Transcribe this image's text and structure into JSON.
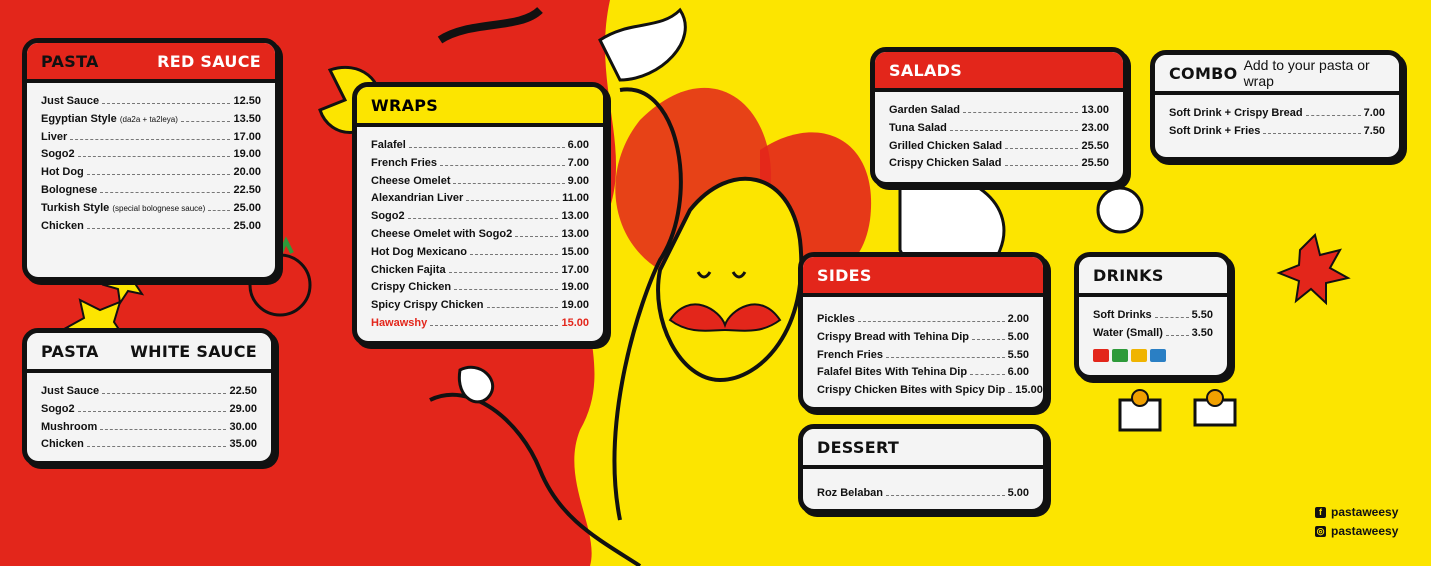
{
  "colors": {
    "red": "#e3261b",
    "yellow": "#fce500",
    "ink": "#111111"
  },
  "pasta_red": {
    "title": "PASTA",
    "subtitle": "RED SAUCE",
    "items": [
      {
        "name": "Just Sauce",
        "note": "",
        "price": "12.50"
      },
      {
        "name": "Egyptian Style",
        "note": "(da2a + ta2leya)",
        "price": "13.50"
      },
      {
        "name": "Liver",
        "note": "",
        "price": "17.00"
      },
      {
        "name": "Sogo2",
        "note": "",
        "price": "19.00"
      },
      {
        "name": "Hot Dog",
        "note": "",
        "price": "20.00"
      },
      {
        "name": "Bolognese",
        "note": "",
        "price": "22.50"
      },
      {
        "name": "Turkish Style",
        "note": "(special bolognese sauce)",
        "price": "25.00"
      },
      {
        "name": "Chicken",
        "note": "",
        "price": "25.00"
      }
    ]
  },
  "pasta_white": {
    "title": "PASTA",
    "subtitle": "WHITE SAUCE",
    "items": [
      {
        "name": "Just Sauce",
        "price": "22.50"
      },
      {
        "name": "Sogo2",
        "price": "29.00"
      },
      {
        "name": "Mushroom",
        "price": "30.00"
      },
      {
        "name": "Chicken",
        "price": "35.00"
      }
    ]
  },
  "wraps": {
    "title": "WRAPS",
    "items": [
      {
        "name": "Falafel",
        "price": "6.00"
      },
      {
        "name": "French Fries",
        "price": "7.00"
      },
      {
        "name": "Cheese Omelet",
        "price": "9.00"
      },
      {
        "name": "Alexandrian Liver",
        "price": "11.00"
      },
      {
        "name": "Sogo2",
        "price": "13.00"
      },
      {
        "name": "Cheese Omelet with Sogo2",
        "price": "13.00"
      },
      {
        "name": "Hot Dog Mexicano",
        "price": "15.00"
      },
      {
        "name": "Chicken Fajita",
        "price": "17.00"
      },
      {
        "name": "Crispy Chicken",
        "price": "19.00"
      },
      {
        "name": "Spicy Crispy Chicken",
        "price": "19.00"
      },
      {
        "name": "Hawawshy",
        "price": "15.00",
        "highlight": true
      }
    ]
  },
  "salads": {
    "title": "SALADS",
    "items": [
      {
        "name": "Garden Salad",
        "price": "13.00"
      },
      {
        "name": "Tuna Salad",
        "price": "23.00"
      },
      {
        "name": "Grilled Chicken Salad",
        "price": "25.50"
      },
      {
        "name": "Crispy Chicken Salad",
        "price": "25.50"
      }
    ]
  },
  "combo": {
    "title": "COMBO",
    "subtitle": "Add to your pasta or wrap",
    "items": [
      {
        "name": "Soft Drink + Crispy Bread",
        "price": "7.00"
      },
      {
        "name": "Soft Drink + Fries",
        "price": "7.50"
      }
    ]
  },
  "sides": {
    "title": "SIDES",
    "items": [
      {
        "name": "Pickles",
        "price": "2.00"
      },
      {
        "name": "Crispy Bread with Tehina Dip",
        "price": "5.00"
      },
      {
        "name": "French Fries",
        "price": "5.50"
      },
      {
        "name": "Falafel Bites With Tehina Dip",
        "price": "6.00"
      },
      {
        "name": "Crispy Chicken Bites with Spicy Dip",
        "price": "15.00"
      }
    ]
  },
  "drinks": {
    "title": "DRINKS",
    "items": [
      {
        "name": "Soft Drinks",
        "price": "5.50"
      },
      {
        "name": "Water (Small)",
        "price": "3.50"
      }
    ],
    "logos": [
      {
        "icon": "coca-cola-logo",
        "color": "#e3261b"
      },
      {
        "icon": "sprite-logo",
        "color": "#2e9a3a"
      },
      {
        "icon": "fanta-logo",
        "color": "#f0b400"
      },
      {
        "icon": "dasani-logo",
        "color": "#2a7fc4"
      }
    ]
  },
  "dessert": {
    "title": "DESSERT",
    "items": [
      {
        "name": "Roz Belaban",
        "price": "5.00"
      }
    ]
  },
  "social": [
    {
      "icon": "facebook-icon",
      "handle": "pastaweesy"
    },
    {
      "icon": "instagram-icon",
      "handle": "pastaweesy"
    }
  ]
}
